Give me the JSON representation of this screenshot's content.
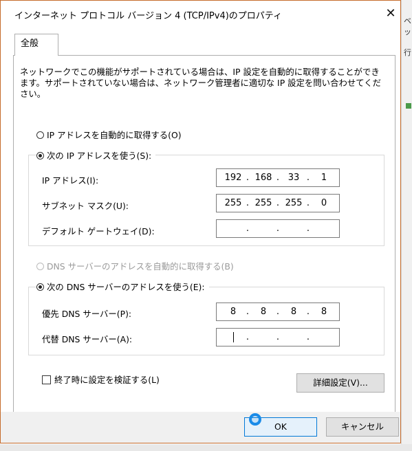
{
  "window": {
    "title": "インターネット プロトコル バージョン 4 (TCP/IPv4)のプロパティ",
    "close_glyph": "✕"
  },
  "background": {
    "text1": "ベッ",
    "text2": "行"
  },
  "tabs": [
    {
      "label": "全般"
    }
  ],
  "description": "ネットワークでこの機能がサポートされている場合は、IP 設定を自動的に取得することができます。サポートされていない場合は、ネットワーク管理者に適切な IP 設定を問い合わせてください。",
  "ip_mode": {
    "auto_label": "IP アドレスを自動的に取得する(O)",
    "manual_label": "次の IP アドレスを使う(S):",
    "selected": "manual"
  },
  "ip_fields": {
    "ip_label": "IP アドレス(I):",
    "ip_value": [
      "192",
      "168",
      "33",
      "1"
    ],
    "mask_label": "サブネット マスク(U):",
    "mask_value": [
      "255",
      "255",
      "255",
      "0"
    ],
    "gateway_label": "デフォルト ゲートウェイ(D):",
    "gateway_value": [
      "",
      "",
      "",
      ""
    ]
  },
  "dns_mode": {
    "auto_label": "DNS サーバーのアドレスを自動的に取得する(B)",
    "auto_disabled": true,
    "manual_label": "次の DNS サーバーのアドレスを使う(E):",
    "selected": "manual"
  },
  "dns_fields": {
    "preferred_label": "優先 DNS サーバー(P):",
    "preferred_value": [
      "8",
      "8",
      "8",
      "8"
    ],
    "alternate_label": "代替 DNS サーバー(A):",
    "alternate_value": [
      "",
      "",
      "",
      ""
    ]
  },
  "validate_checkbox": {
    "label": "終了時に設定を検証する(L)",
    "checked": false
  },
  "buttons": {
    "advanced": "詳細設定(V)...",
    "ok": "OK",
    "cancel": "キャンセル"
  },
  "colors": {
    "accent": "#0078d7",
    "window_border": "#c56b2b",
    "click_marker": "#1a8be8"
  }
}
